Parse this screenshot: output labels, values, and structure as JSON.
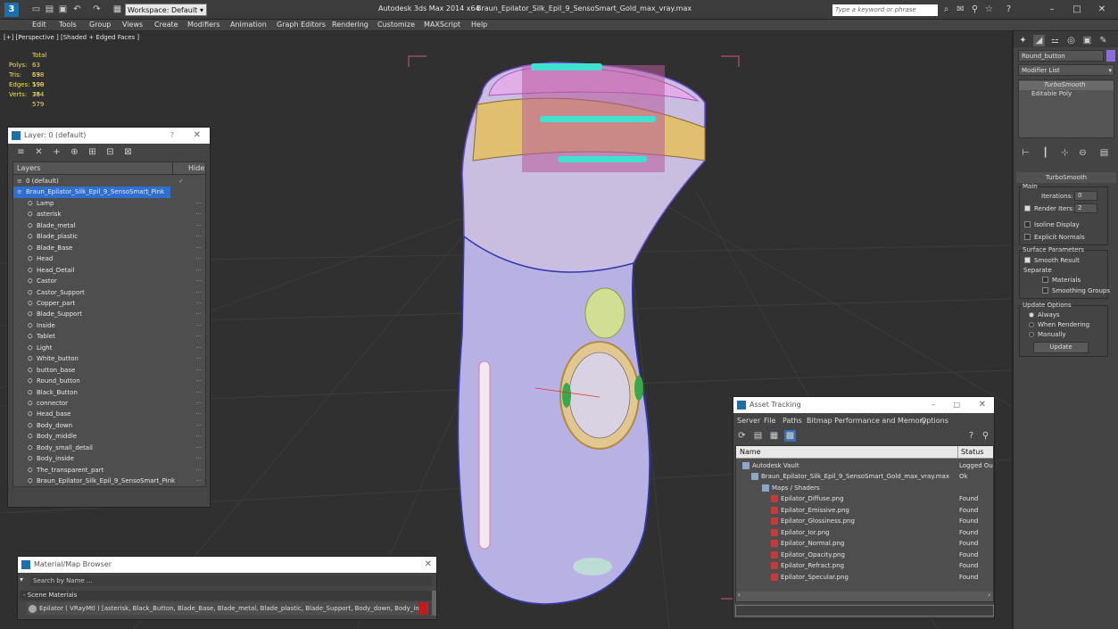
{
  "titlebar": {
    "workspace": "Workspace: Default",
    "app_title": "Autodesk 3ds Max  2014 x64",
    "file_title": "Braun_Epilator_Silk_Epil_9_SensoSmart_Gold_max_vray.max",
    "search_placeholder": "Type a keyword or phrase"
  },
  "menu": [
    "Edit",
    "Tools",
    "Group",
    "Views",
    "Create",
    "Modifiers",
    "Animation",
    "Graph Editors",
    "Rendering",
    "Customize",
    "MAXScript",
    "Help"
  ],
  "viewport": {
    "label": "[+] [Perspective ] [Shaded + Edged Faces ]",
    "stats": {
      "header": "Total",
      "rows": [
        {
          "k": "Polys:",
          "v": "63 598"
        },
        {
          "k": "Tris:",
          "v": "63 598"
        },
        {
          "k": "Edges:",
          "v": "190 794"
        },
        {
          "k": "Verts:",
          "v": "36 579"
        }
      ]
    }
  },
  "layers": {
    "title": "Layer: 0 (default)",
    "col_layers": "Layers",
    "col_hide": "Hide",
    "items": [
      "0 (default)",
      "Braun_Epilator_Silk_Epil_9_SensoSmart_Pink",
      "Lamp",
      "asterisk",
      "Blade_metal",
      "Blade_plastic",
      "Blade_Base",
      "Head",
      "Head_Detail",
      "Castor",
      "Castor_Support",
      "Copper_part",
      "Blade_Support",
      "Inside",
      "Tablet",
      "Light",
      "White_button",
      "button_base",
      "Round_button",
      "Black_Button",
      "connector",
      "Head_base",
      "Body_down",
      "Body_middle",
      "Body_small_detail",
      "Body_inside",
      "The_transparent_part",
      "Braun_Epilator_Silk_Epil_9_SensoSmart_Pink"
    ]
  },
  "command_panel": {
    "object_name": "Round_button",
    "modifier_list": "Modifier List",
    "stack": [
      "TurboSmooth",
      "Editable Poly"
    ],
    "rollout_title": "TurboSmooth",
    "main": "Main",
    "iterations_label": "Iterations:",
    "iterations_value": "0",
    "render_iters_label": "Render Iters:",
    "render_iters_value": "2",
    "isoline": "Isoline Display",
    "explicit_normals": "Explicit Normals",
    "surface_params": "Surface Parameters",
    "smooth_result": "Smooth Result",
    "separate": "Separate",
    "materials": "Materials",
    "smoothing_groups": "Smoothing Groups",
    "update_options": "Update Options",
    "always": "Always",
    "when_rendering": "When Rendering",
    "manually": "Manually",
    "update_button": "Update"
  },
  "asset_tracking": {
    "title": "Asset Tracking",
    "menu": [
      "Server",
      "File",
      "Paths",
      "Bitmap Performance and Memory",
      "Options"
    ],
    "col_name": "Name",
    "col_status": "Status",
    "rows": [
      {
        "name": "Autodesk Vault",
        "status": "Logged Ou"
      },
      {
        "name": "Braun_Epilator_Silk_Epil_9_SensoSmart_Gold_max_vray.max",
        "status": "Ok"
      },
      {
        "name": "Maps / Shaders",
        "status": ""
      },
      {
        "name": "Epilator_Diffuse.png",
        "status": "Found"
      },
      {
        "name": "Epilator_Emissive.png",
        "status": "Found"
      },
      {
        "name": "Epilator_Glossiness.png",
        "status": "Found"
      },
      {
        "name": "Epilator_Ior.png",
        "status": "Found"
      },
      {
        "name": "Epilator_Normal.png",
        "status": "Found"
      },
      {
        "name": "Epilator_Opacity.png",
        "status": "Found"
      },
      {
        "name": "Epilator_Refract.png",
        "status": "Found"
      },
      {
        "name": "Epilator_Specular.png",
        "status": "Found"
      }
    ]
  },
  "material_browser": {
    "title": "Material/Map Browser",
    "search_placeholder": "Search by Name ...",
    "section": "- Scene Materials",
    "material": "Epilator ( VRayMtl ) [asterisk, Black_Button, Blade_Base, Blade_metal, Blade_plastic, Blade_Support, Body_down, Body_inside,..."
  }
}
